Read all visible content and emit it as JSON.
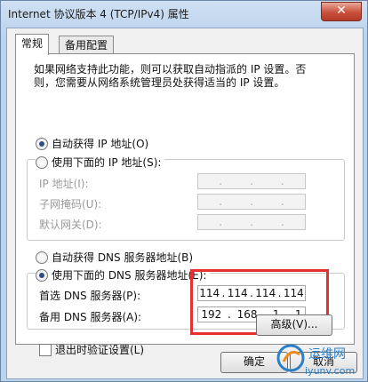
{
  "window": {
    "title": "Internet 协议版本 4 (TCP/IPv4) 属性",
    "close_symbol": "✕"
  },
  "tabs": [
    {
      "label": "常规"
    },
    {
      "label": "备用配置"
    }
  ],
  "description": "如果网络支持此功能，则可以获取自动指派的 IP 设置。否则，您需要从网络系统管理员处获得适当的 IP 设置。",
  "ip_section": {
    "auto_label": "自动获得 IP 地址(O)",
    "manual_label": "使用下面的 IP 地址(S):",
    "selected": "auto",
    "fields": [
      {
        "label": "IP 地址(I):",
        "value": [
          "",
          "",
          "",
          ""
        ]
      },
      {
        "label": "子网掩码(U):",
        "value": [
          "",
          "",
          "",
          ""
        ]
      },
      {
        "label": "默认网关(D):",
        "value": [
          "",
          "",
          "",
          ""
        ]
      }
    ]
  },
  "dns_section": {
    "auto_label": "自动获得 DNS 服务器地址(B)",
    "manual_label": "使用下面的 DNS 服务器地址(E):",
    "selected": "manual",
    "preferred_label": "首选 DNS 服务器(P):",
    "preferred_value": [
      "114",
      "114",
      "114",
      "114"
    ],
    "alternate_label": "备用 DNS 服务器(A):",
    "alternate_value": [
      "192",
      "168",
      "1",
      "1"
    ]
  },
  "validate_label": "退出时验证设置(L)",
  "advanced_label": "高级(V)...",
  "ok_label": "确定",
  "cancel_label": "取消",
  "watermark": {
    "top": "运维网",
    "bottom": "iyunv.com"
  }
}
